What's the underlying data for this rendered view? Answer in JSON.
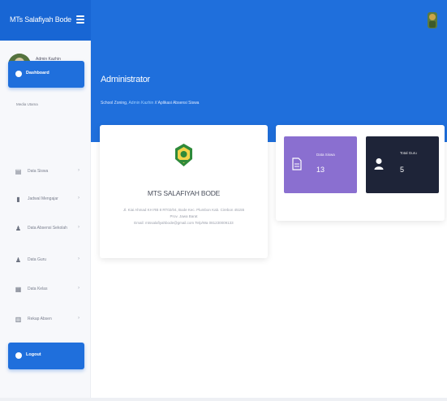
{
  "app": {
    "brand": "MTs Salafiyah Bode"
  },
  "topbar": {
    "menu_icon": "hamburger-icon",
    "avatar_icon": "user-avatar-icon"
  },
  "sidebar": {
    "profile": {
      "name": "Admin Kazhin",
      "role": "Administrator"
    },
    "dashboard_label": "Dashboard",
    "section_label": "Media Utama",
    "items": [
      {
        "label": "Data Siswa",
        "icon": "document-icon"
      },
      {
        "label": "Jadwal Mengajar",
        "icon": "book-icon"
      },
      {
        "label": "Data Absensi Sekolah",
        "icon": "users-icon"
      },
      {
        "label": "Data Guru",
        "icon": "user-icon"
      },
      {
        "label": "Data Kelas",
        "icon": "grid-icon"
      },
      {
        "label": "Rekap Absen",
        "icon": "clipboard-icon"
      }
    ],
    "logout_label": "Logout"
  },
  "header": {
    "title": "Administrator",
    "breadcrumb_prefix": "School Zoning, ",
    "breadcrumb_link": "Admin Kazhin",
    "breadcrumb_suffix": " // Aplikasi Absensi Siswa"
  },
  "school": {
    "name": "MTS SALAFIYAH BODE",
    "address_line1": "Jl. Kiai Ahmad KH RB 8 RT02/04, Bode Kec. Plumbon Kab. Cirebon 45155",
    "address_line2": "Prov. Jawa Barat",
    "address_line3": "Email: mtssalafiyahbode@gmail.com Telp/Wa 081230009133"
  },
  "stats": {
    "siswa": {
      "label": "Data Siswa",
      "value": "13",
      "color": "#8a6fd0"
    },
    "guru": {
      "label": "Total Guru",
      "value": "5",
      "color": "#1e2438"
    }
  },
  "colors": {
    "primary": "#1f6fdc",
    "siswa": "#8a6fd0",
    "guru": "#1e2438"
  }
}
